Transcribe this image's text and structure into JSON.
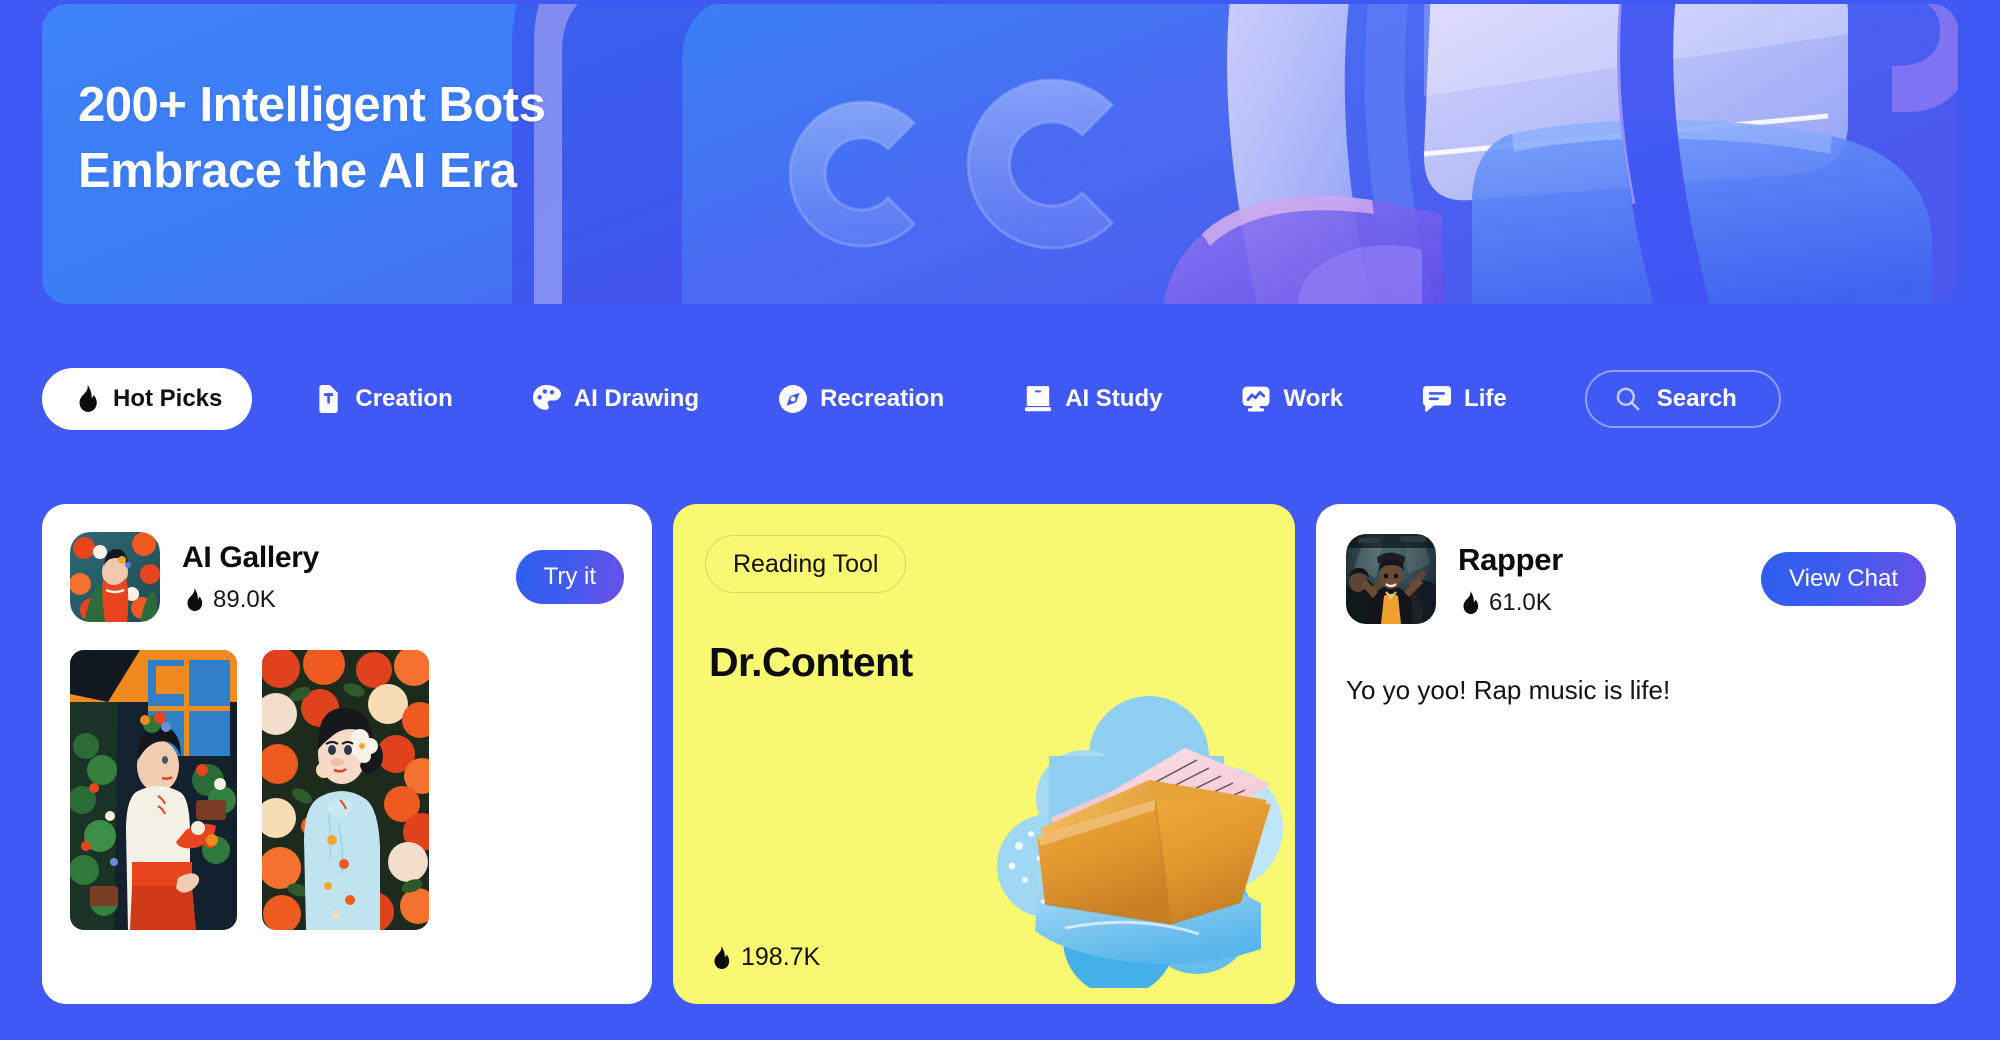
{
  "hero": {
    "title_line1": "200+ Intelligent Bots",
    "title_line2": "Embrace the AI Era",
    "art_label": "glass-cc-abstract-illustration",
    "bg_color": "#3E82F7",
    "accent_color": "#5560F0"
  },
  "page": {
    "background_color": "#4059F5"
  },
  "nav": {
    "tabs": [
      {
        "label": "Hot Picks",
        "icon": "flame-icon",
        "active": true
      },
      {
        "label": "Creation",
        "icon": "document-t-icon",
        "active": false
      },
      {
        "label": "AI Drawing",
        "icon": "palette-icon",
        "active": false
      },
      {
        "label": "Recreation",
        "icon": "compass-icon",
        "active": false
      },
      {
        "label": "AI Study",
        "icon": "book-icon",
        "active": false
      },
      {
        "label": "Work",
        "icon": "monitor-chart-icon",
        "active": false
      },
      {
        "label": "Life",
        "icon": "chat-bubble-icon",
        "active": false
      }
    ],
    "search": {
      "label": "Search",
      "placeholder": "Search",
      "icon": "search-icon"
    }
  },
  "cards": [
    {
      "id": "ai-gallery",
      "type": "gallery",
      "name": "AI Gallery",
      "stat": "89.0K",
      "stat_icon": "flame-icon",
      "button_label": "Try it",
      "avatar_label": "ai-gallery-avatar",
      "thumbs": [
        {
          "label": "ai-art-girl-in-white-hanfu-with-flowers"
        },
        {
          "label": "ai-art-girl-in-blue-cheongsam-with-flowers"
        }
      ],
      "bg_color": "#FFFFFF"
    },
    {
      "id": "dr-content",
      "type": "feature",
      "tag": "Reading Tool",
      "title": "Dr.Content",
      "stat": "198.7K",
      "stat_icon": "flame-icon",
      "art_label": "open-book-folder-illustration",
      "bg_color": "#F9F871"
    },
    {
      "id": "rapper",
      "type": "chat",
      "name": "Rapper",
      "stat": "61.0K",
      "stat_icon": "flame-icon",
      "button_label": "View Chat",
      "avatar_label": "rapper-avatar-photo",
      "message": "Yo yo yoo! Rap music is life!",
      "bg_color": "#FFFFFF"
    }
  ]
}
